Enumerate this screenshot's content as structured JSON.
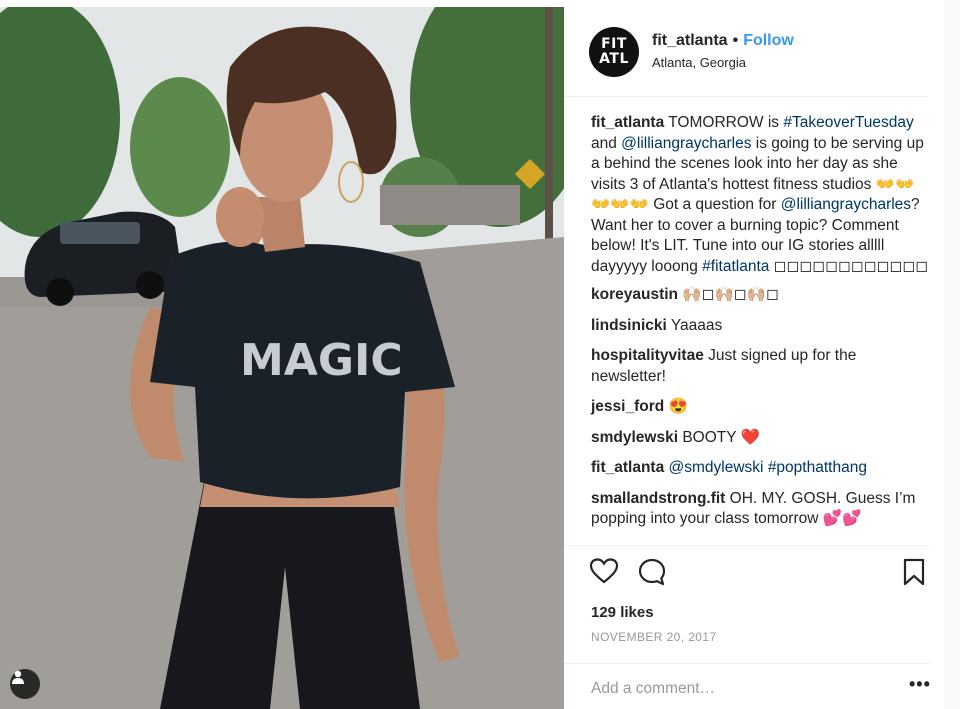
{
  "post": {
    "username": "fit_atlanta",
    "separator": "•",
    "follow_label": "Follow",
    "location": "Atlanta, Georgia",
    "avatar_text": {
      "line1": "FIT",
      "line2": "ATL",
      "line3": ""
    },
    "photo": {
      "shirt_text": "MAGIC",
      "icon": "user-tag-icon",
      "colors": {
        "shirt": "#1b2129",
        "shirt_print": "#c7ccd1",
        "hair": "#4a2f22",
        "skin": "#c48f72"
      }
    }
  },
  "comments": [
    {
      "username": "fit_atlanta",
      "segments": [
        {
          "text": " TOMORROW is ",
          "link": false
        },
        {
          "text": "#TakeoverTuesday",
          "link": true
        },
        {
          "text": " and ",
          "link": false
        },
        {
          "text": "@lilliangraycharles",
          "link": true
        },
        {
          "text": " is going to be serving up a behind the scenes look into her day as she visits 3 of Atlanta's hottest fitness studios 👐👐👐👐👐 Got a question for ",
          "link": false
        },
        {
          "text": "@lilliangraycharles",
          "link": true
        },
        {
          "text": "? Want her to cover a burning topic? Comment below! It's LIT. Tune into our IG stories alllll dayyyyy looong ",
          "link": false
        },
        {
          "text": "#fitatlanta",
          "link": true
        },
        {
          "text": " ◻◻◻◻◻◻◻◻◻◻◻◻",
          "link": false
        }
      ]
    },
    {
      "username": "koreyaustin",
      "segments": [
        {
          "text": " 🙌🏼◻🙌🏼◻🙌🏼◻",
          "link": false
        }
      ]
    },
    {
      "username": "lindsinicki",
      "segments": [
        {
          "text": " Yaaaas",
          "link": false
        }
      ]
    },
    {
      "username": "hospitalityvitae",
      "segments": [
        {
          "text": " Just signed up for the newsletter!",
          "link": false
        }
      ]
    },
    {
      "username": "jessi_ford",
      "segments": [
        {
          "text": " 😍",
          "link": false
        }
      ]
    },
    {
      "username": "smdylewski",
      "segments": [
        {
          "text": " BOOTY ❤️",
          "link": false
        }
      ]
    },
    {
      "username": "fit_atlanta",
      "segments": [
        {
          "text": " ",
          "link": false
        },
        {
          "text": "@smdylewski",
          "link": true
        },
        {
          "text": " ",
          "link": false
        },
        {
          "text": "#popthatthang",
          "link": true
        }
      ]
    },
    {
      "username": "smallandstrong.fit",
      "segments": [
        {
          "text": " OH. MY. GOSH. Guess I’m popping into your class tomorrow 💕💕",
          "link": false
        }
      ]
    }
  ],
  "actions": {
    "like_icon": "heart-icon",
    "comment_icon": "comment-bubble-icon",
    "save_icon": "bookmark-icon",
    "likes_text": "129 likes",
    "date_text": "NOVEMBER 20, 2017"
  },
  "add_comment": {
    "placeholder": "Add a comment…",
    "more_label": "•••"
  }
}
